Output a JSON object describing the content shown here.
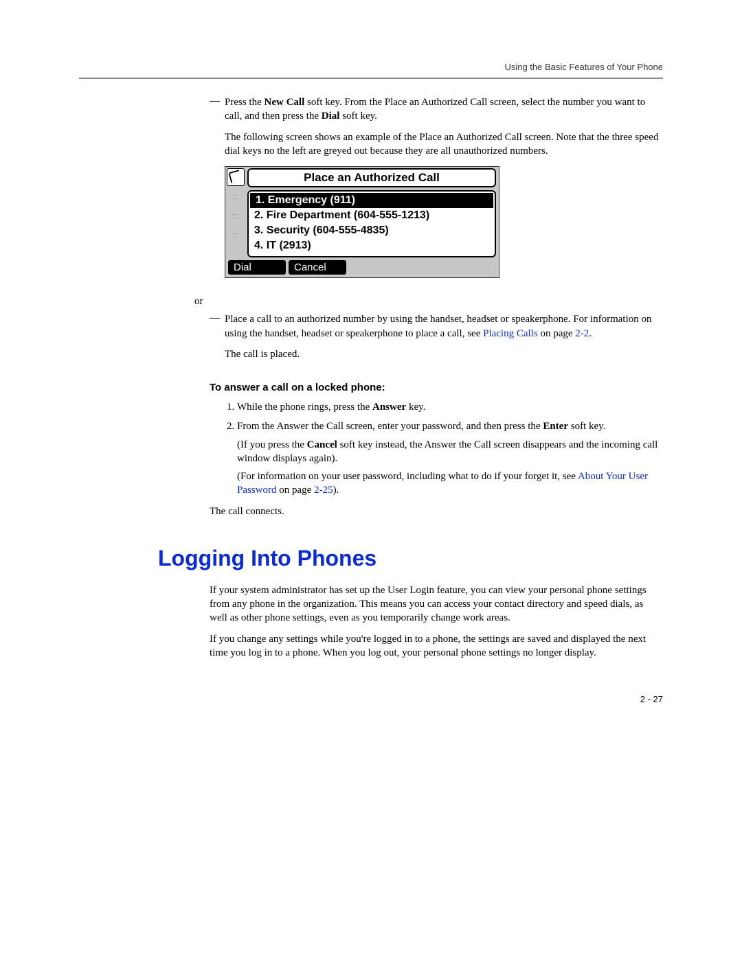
{
  "running_head": "Using the Basic Features of Your Phone",
  "bullet1": {
    "dash": "—",
    "pre": "Press the ",
    "b1": "New Call",
    "mid": " soft key. From the Place an Authorized Call screen, select the number you want to call, and then press the ",
    "b2": "Dial",
    "post": " soft key."
  },
  "intro2": "The following screen shows an example of the Place an Authorized Call screen. Note that the three speed dial keys no the left are greyed out because they are all unauthorized numbers.",
  "screenshot": {
    "title": "Place an Authorized Call",
    "ghost": ":::",
    "rows": [
      "1. Emergency (911)",
      "2. Fire Department (604-555-1213)",
      "3. Security (604-555-4835)",
      "4. IT (2913)"
    ],
    "softkeys": [
      "Dial",
      "Cancel"
    ]
  },
  "or_text": "or",
  "bullet2": {
    "dash": "—",
    "text_a": "Place a call to an authorized number by using the handset, headset or speakerphone. For information on using the handset, headset or speakerphone to place a call, see ",
    "link": "Placing Calls",
    "text_b": " on page ",
    "pref": "2-2",
    "text_c": "."
  },
  "call_placed": "The call is placed.",
  "subhead": "To answer a call on a locked phone:",
  "step1": {
    "pre": "While the phone rings, press the ",
    "b": "Answer",
    "post": " key."
  },
  "step2": {
    "pre": "From the Answer the Call screen, enter your password, and then press the ",
    "b": "Enter",
    "post": " soft key.",
    "paren1a": "(If you press the ",
    "paren1b": "Cancel",
    "paren1c": " soft key instead, the Answer the Call screen disappears and the incoming call window displays again).",
    "paren2a": "(For information on your user password, including what to do if your forget it, see ",
    "paren2link": "About Your User Password",
    "paren2b": " on page ",
    "paren2pref": "2-25",
    "paren2c": ")."
  },
  "call_connects": "The call connects.",
  "section_title": "Logging Into Phones",
  "body1": "If your system administrator has set up the User Login feature, you can view your personal phone settings from any phone in the organization. This means you can access your contact directory and speed dials, as well as other phone settings, even as you temporarily change work areas.",
  "body2": "If you change any settings while you're logged in to a phone, the settings are saved and displayed the next time you log in to a phone. When you log out, your personal phone settings no longer display.",
  "page_num": "2 - 27"
}
